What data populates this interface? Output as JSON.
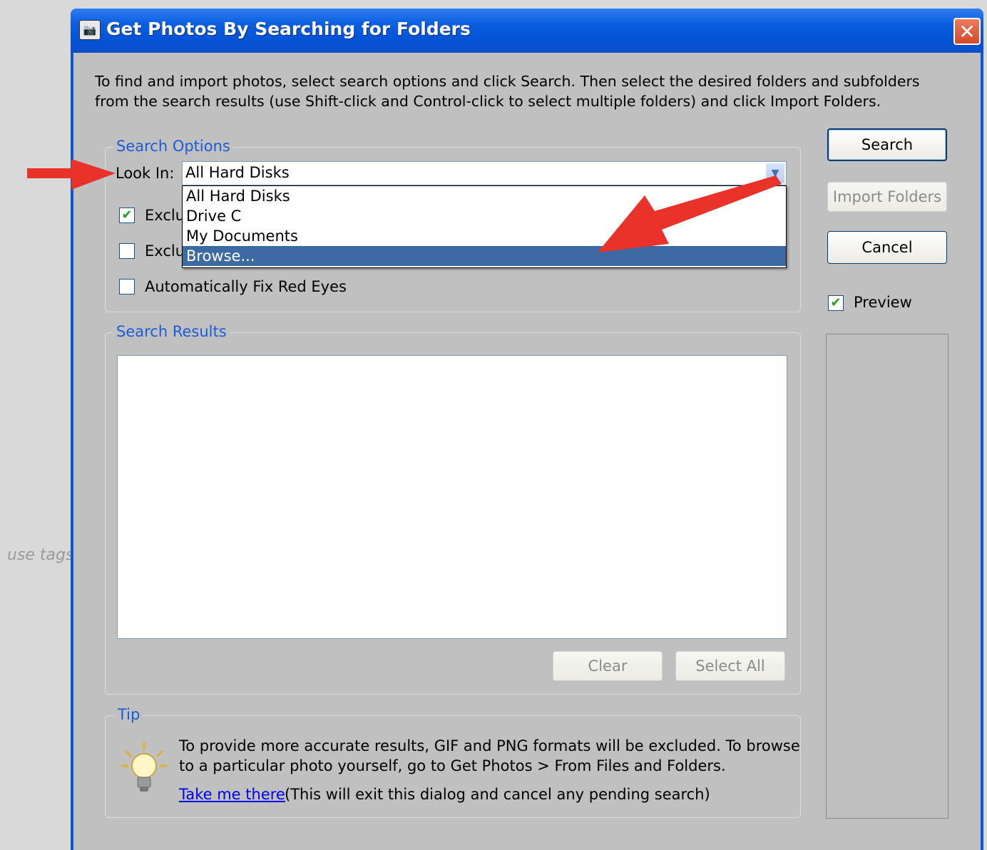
{
  "background": {
    "text": "use tags"
  },
  "window": {
    "title": "Get Photos By Searching for Folders",
    "close_glyph": "✕",
    "icon": "camera-icon"
  },
  "instructions": "To find and import photos, select search options and click Search. Then select the desired folders and subfolders from the search results (use Shift-click and Control-click to select multiple folders) and click Import Folders.",
  "search_options": {
    "legend": "Search Options",
    "look_in_label": "Look In:",
    "look_in_value": "All Hard Disks",
    "dropdown_items": [
      "All Hard Disks",
      "Drive C",
      "My Documents",
      "Browse..."
    ],
    "selected_item": "Browse...",
    "checkbox1_label": "Exclu",
    "checkbox1_checked": true,
    "checkbox2_label": "Exclu",
    "checkbox2_checked": false,
    "checkbox3_label": "Automatically Fix Red Eyes",
    "checkbox3_checked": false
  },
  "search_results": {
    "legend": "Search Results",
    "clear_label": "Clear",
    "select_all_label": "Select All"
  },
  "tip": {
    "legend": "Tip",
    "text": "To provide more accurate results, GIF and PNG formats will be excluded. To browse to a particular photo yourself, go to Get Photos > From Files and Folders.",
    "link": "Take me there",
    "note": "(This will exit this dialog and cancel any pending search)"
  },
  "buttons": {
    "search": "Search",
    "import_folders": "Import Folders",
    "cancel": "Cancel"
  },
  "preview": {
    "label": "Preview",
    "checked": true
  },
  "colors": {
    "titlebar": "#0a5ee0",
    "dialog_bg": "#c0c0c0",
    "legend_text": "#1d5bd6",
    "selection": "#3d6aa3",
    "annotation_arrow": "#e8322a"
  }
}
